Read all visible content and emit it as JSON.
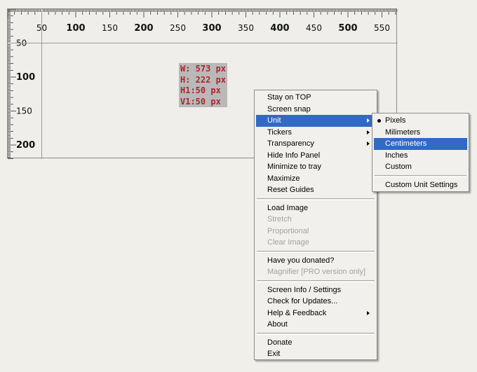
{
  "ruler": {
    "x_ticks": [
      "50",
      "100",
      "150",
      "200",
      "250",
      "300",
      "350",
      "400",
      "450",
      "500",
      "550"
    ],
    "y_ticks": [
      "50",
      "100",
      "150",
      "200"
    ]
  },
  "info_panel": {
    "width": "W: 573 px",
    "height": "H: 222 px",
    "h1": "H1:50 px",
    "v1": "V1:50 px"
  },
  "context_menu": {
    "stay_on_top": "Stay on TOP",
    "screen_snap": "Screen snap",
    "unit": "Unit",
    "tickers": "Tickers",
    "transparency": "Transparency",
    "hide_info_panel": "Hide Info Panel",
    "minimize_to_tray": "Minimize to tray",
    "maximize": "Maximize",
    "reset_guides": "Reset Guides",
    "load_image": "Load Image",
    "stretch": "Stretch",
    "proportional": "Proportional",
    "clear_image": "Clear Image",
    "have_you_donated": "Have you donated?",
    "magnifier": "Magnifier [PRO version only]",
    "screen_info_settings": "Screen Info / Settings",
    "check_for_updates": "Check for Updates...",
    "help_feedback": "Help & Feedback",
    "about": "About",
    "donate": "Donate",
    "exit": "Exit"
  },
  "unit_submenu": {
    "pixels": "Pixels",
    "milimeters": "Milimeters",
    "centimeters": "Centimeters",
    "inches": "Inches",
    "custom": "Custom",
    "custom_unit_settings": "Custom Unit Settings",
    "selected": "Pixels",
    "highlighted": "Centimeters"
  },
  "colors": {
    "highlight": "#316ac5",
    "info_text": "#b3232a",
    "info_bg": "#b9b9b9"
  }
}
